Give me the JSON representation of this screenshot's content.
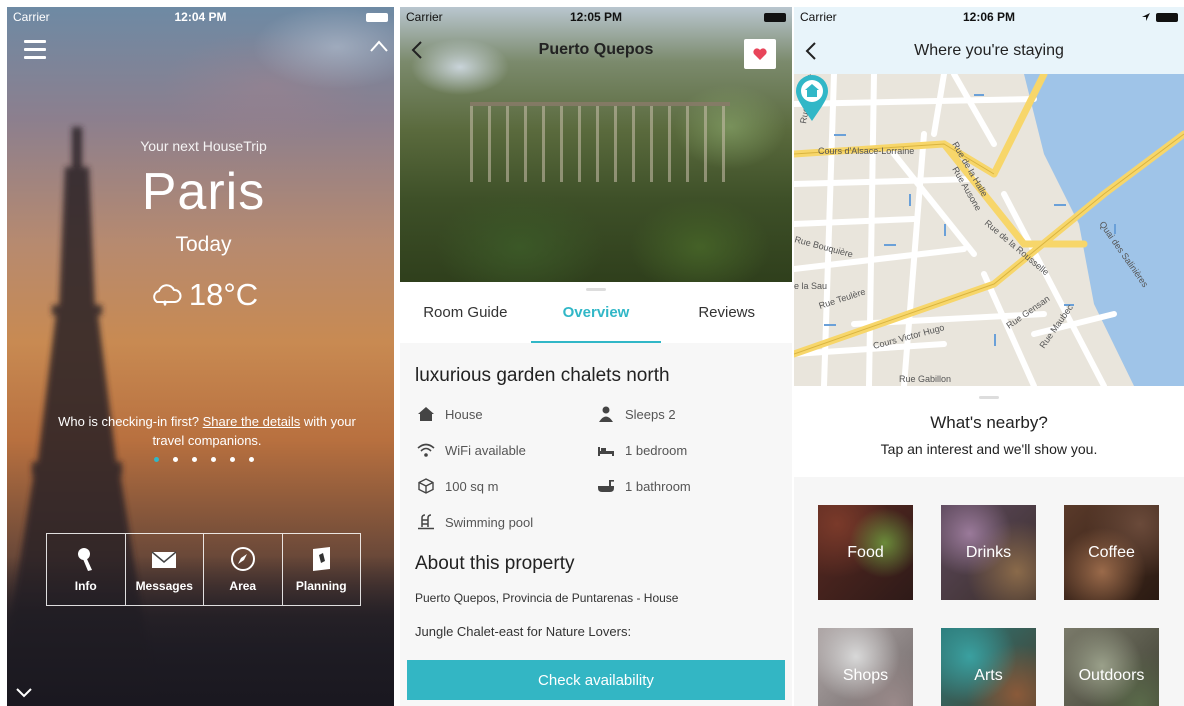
{
  "panel_home": {
    "status": {
      "carrier": "Carrier",
      "time": "12:04 PM"
    },
    "next_label": "Your next HouseTrip",
    "city": "Paris",
    "day": "Today",
    "temperature": "18°C",
    "checkin_prefix": "Who is checking-in first?",
    "checkin_link": "Share the details",
    "checkin_suffix": "with your travel companions.",
    "page_dots": {
      "count": 6,
      "active_index": 0
    },
    "nav": [
      {
        "label": "Info",
        "icon": "key-icon"
      },
      {
        "label": "Messages",
        "icon": "envelope-icon"
      },
      {
        "label": "Area",
        "icon": "compass-icon"
      },
      {
        "label": "Planning",
        "icon": "planning-icon"
      }
    ]
  },
  "panel_property": {
    "status": {
      "carrier": "Carrier",
      "time": "12:05 PM"
    },
    "title": "Puerto Quepos",
    "tabs": [
      "Room Guide",
      "Overview",
      "Reviews"
    ],
    "active_tab": "Overview",
    "listing_title": "luxurious garden chalets north",
    "amenities": {
      "type": "House",
      "sleeps": "Sleeps 2",
      "wifi": "WiFi available",
      "bedrooms": "1 bedroom",
      "size": "100 sq m",
      "bathrooms": "1 bathroom",
      "pool": "Swimming pool"
    },
    "about_title": "About this property",
    "about_location": "Puerto Quepos, Provincia de Puntarenas - House",
    "about_description": "Jungle Chalet-east for Nature Lovers:",
    "cta": "Check availability",
    "accent_color": "#31b7c7"
  },
  "panel_area": {
    "status": {
      "carrier": "Carrier",
      "time": "12:06 PM"
    },
    "title": "Where you're staying",
    "map_labels": {
      "street1": "Cours d'Alsace-Lorraine",
      "street2": "Rue de la Halle",
      "street3": "Rue Ausone",
      "street4": "Rue Bouquière",
      "street5": "Rue Teulère",
      "street6": "Cours Victor Hugo",
      "street7": "Quai des Salinières",
      "street8": "Rue Gensan",
      "street9": "Rue Maubec",
      "street10": "Rue Gabillon",
      "street11": "Rue de la Rousselle",
      "street12": "e la Sau",
      "street13": "Rue des Bah"
    },
    "nearby_title": "What's nearby?",
    "nearby_subtitle": "Tap an interest and we'll show you.",
    "interests": [
      "Food",
      "Drinks",
      "Coffee",
      "Shops",
      "Arts",
      "Outdoors"
    ]
  }
}
